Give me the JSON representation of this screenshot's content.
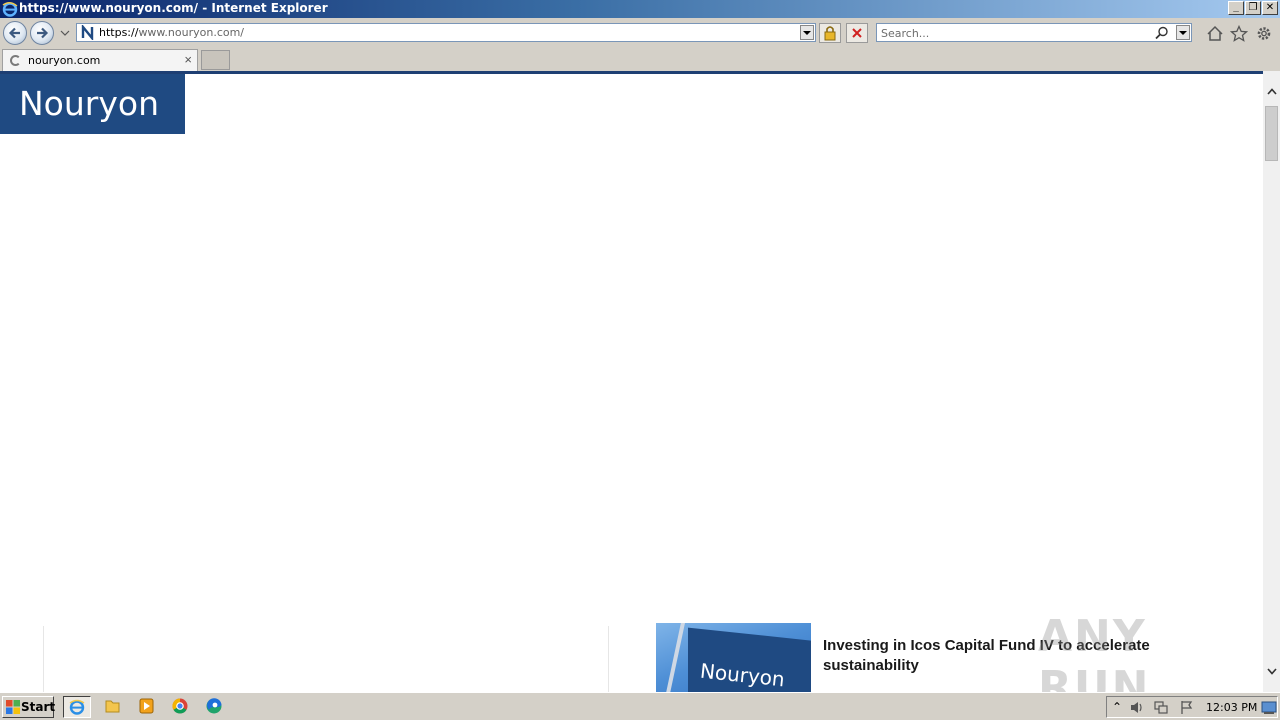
{
  "window": {
    "title": "https://www.nouryon.com/ - Internet Explorer",
    "controls": {
      "minimize": "_",
      "restore": "❐",
      "close": "✕"
    }
  },
  "navbar": {
    "address_prefix": "https://",
    "address_main": "www.nouryon.com/",
    "search_placeholder": "Search..."
  },
  "tabs": [
    {
      "label": "nouryon.com",
      "close": "×"
    }
  ],
  "page": {
    "logo_text": "Nouryon",
    "flag_text": "Nouryon",
    "news_title": "Investing in Icos Capital Fund IV to accelerate sustainability",
    "watermark": "ANY RUN"
  },
  "scrollbar": {
    "up": "⌃",
    "down": "⌄"
  },
  "taskbar": {
    "start_label": "Start",
    "clock": "12:03 PM",
    "tray_expand": "⌃"
  },
  "colors": {
    "brand_blue": "#1f4a82",
    "chrome_gray": "#d4d0c8",
    "title_gradient_start": "#0a246a"
  }
}
